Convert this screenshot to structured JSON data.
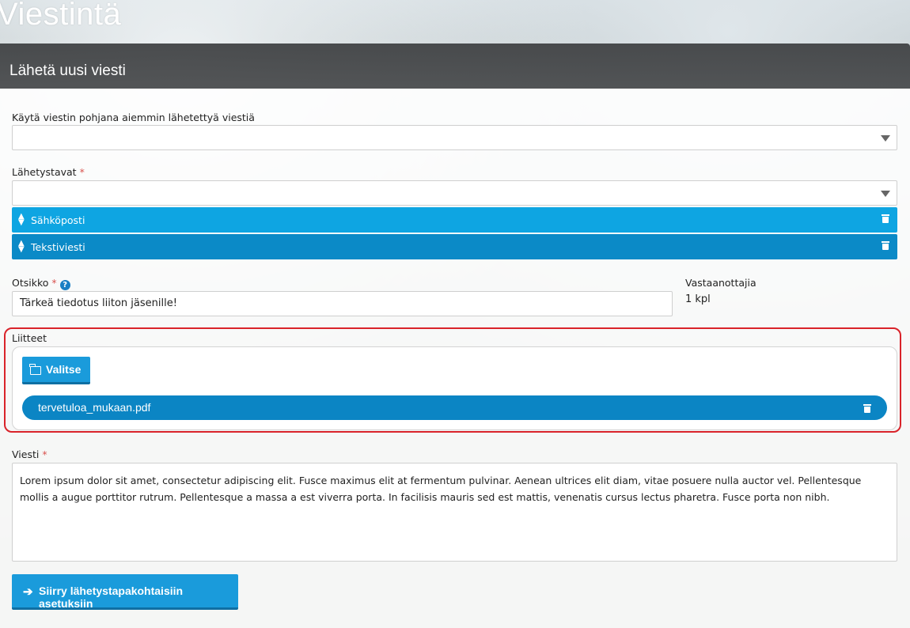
{
  "page": {
    "title": "Viestintä"
  },
  "panel": {
    "title": "Lähetä uusi viesti"
  },
  "template_select": {
    "label": "Käytä viestin pohjana aiemmin lähetettyä viestiä",
    "value": ""
  },
  "methods": {
    "label": "Lähetystavat",
    "required_mark": "*",
    "value": "",
    "items": [
      {
        "label": "Sähköposti",
        "color": "#0ea5e2"
      },
      {
        "label": "Tekstiviesti",
        "color": "#0b8ac7"
      }
    ]
  },
  "subject": {
    "label": "Otsikko",
    "required_mark": "*",
    "help_icon": "?",
    "value": "Tärkeä tiedotus liiton jäsenille!"
  },
  "recipients": {
    "label": "Vastaanottajia",
    "value": "1 kpl"
  },
  "attachments": {
    "label": "Liitteet",
    "choose_button": "Valitse",
    "files": [
      {
        "name": "tervetuloa_mukaan.pdf"
      }
    ]
  },
  "message": {
    "label": "Viesti",
    "required_mark": "*",
    "value": "Lorem ipsum dolor sit amet, consectetur adipiscing elit. Fusce maximus elit at fermentum pulvinar. Aenean ultrices elit diam, vitae posuere nulla auctor vel. Pellentesque mollis a augue porttitor rutrum. Pellentesque a massa a est viverra porta. In facilisis mauris sed est mattis, venenatis cursus lectus pharetra. Fusce porta non nibh."
  },
  "next_button": {
    "label": "Siirry lähetystapakohtaisiin asetuksiin"
  },
  "colors": {
    "primary": "#1a9bdb",
    "pill": "#0b85c4",
    "highlight": "#d9232a",
    "required": "#d9534f"
  }
}
